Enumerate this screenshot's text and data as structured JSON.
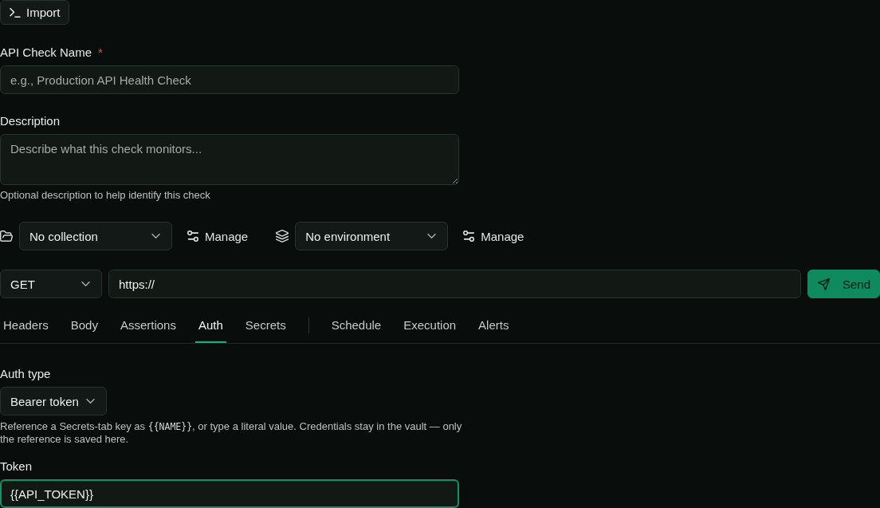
{
  "import_button": {
    "label": "Import"
  },
  "name_field": {
    "label": "API Check Name",
    "required_mark": "*",
    "placeholder": "e.g., Production API Health Check"
  },
  "description_field": {
    "label": "Description",
    "placeholder": "Describe what this check monitors...",
    "help": "Optional description to help identify this check"
  },
  "context_bar": {
    "collection": {
      "value": "No collection",
      "manage_label": "Manage"
    },
    "environment": {
      "value": "No environment",
      "manage_label": "Manage"
    }
  },
  "request": {
    "method": "GET",
    "url": "https://",
    "send_label": "Send"
  },
  "tab_groups": [
    {
      "tabs": [
        {
          "label": "Headers",
          "selected": false
        },
        {
          "label": "Body",
          "selected": false
        },
        {
          "label": "Assertions",
          "selected": false
        },
        {
          "label": "Auth",
          "selected": true
        },
        {
          "label": "Secrets",
          "selected": false
        }
      ]
    },
    {
      "tabs": [
        {
          "label": "Schedule",
          "selected": false
        },
        {
          "label": "Execution",
          "selected": false
        },
        {
          "label": "Alerts",
          "selected": false
        }
      ]
    }
  ],
  "auth": {
    "type_label": "Auth type",
    "type": "Bearer token",
    "hint": {
      "before": "Reference a Secrets-tab key as ",
      "code": "{{NAME}}",
      "after": ", or type a literal value. Credentials stay in the vault — only the reference is saved here."
    },
    "token_field": {
      "label": "Token",
      "value": "{{API_TOKEN}}",
      "focused": true
    }
  }
}
